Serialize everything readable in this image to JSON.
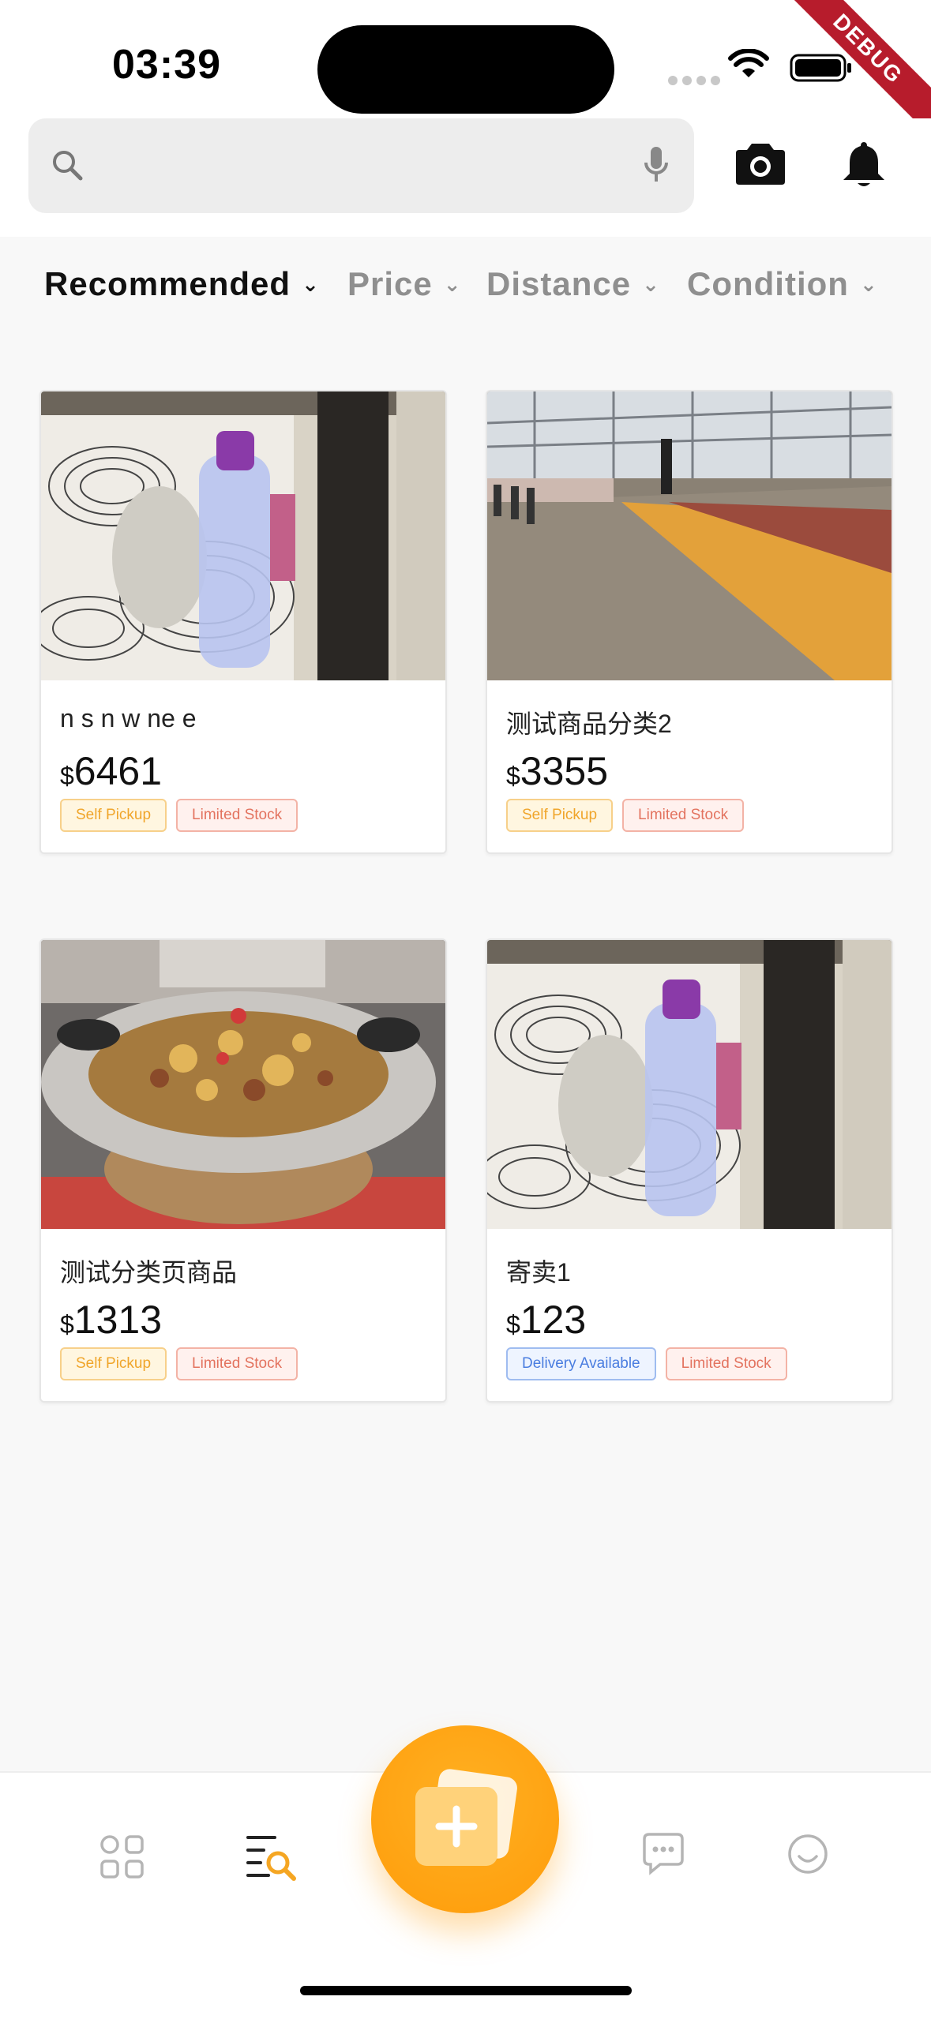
{
  "status_bar": {
    "time": "03:39",
    "debug_label": "DEBUG"
  },
  "search": {
    "placeholder": ""
  },
  "filters": [
    {
      "label": "Recommended",
      "active": true
    },
    {
      "label": "Price",
      "active": false
    },
    {
      "label": "Distance",
      "active": false
    },
    {
      "label": "Condition",
      "active": false
    }
  ],
  "products": [
    {
      "title": "n s n w ne e",
      "currency": "$",
      "price": "6461",
      "image": "desk-bottle-mouse",
      "tags": [
        {
          "label": "Self Pickup",
          "color": "yellow"
        },
        {
          "label": "Limited Stock",
          "color": "red"
        }
      ]
    },
    {
      "title": "测试商品分类2",
      "currency": "$",
      "price": "3355",
      "image": "train-platform",
      "tags": [
        {
          "label": "Self Pickup",
          "color": "yellow"
        },
        {
          "label": "Limited Stock",
          "color": "red"
        }
      ]
    },
    {
      "title": "测试分类页商品",
      "currency": "$",
      "price": "1313",
      "image": "food-pot",
      "tags": [
        {
          "label": "Self Pickup",
          "color": "yellow"
        },
        {
          "label": "Limited Stock",
          "color": "red"
        }
      ]
    },
    {
      "title": "寄卖1",
      "currency": "$",
      "price": "123",
      "image": "desk-bottle-mouse",
      "tags": [
        {
          "label": "Delivery Available",
          "color": "blue"
        },
        {
          "label": "Limited Stock",
          "color": "red"
        }
      ]
    }
  ],
  "nav": {
    "items": [
      "home-grid-icon",
      "search-list-icon",
      "publish-icon",
      "messages-icon",
      "profile-icon"
    ],
    "active_color": "#f5a623"
  }
}
